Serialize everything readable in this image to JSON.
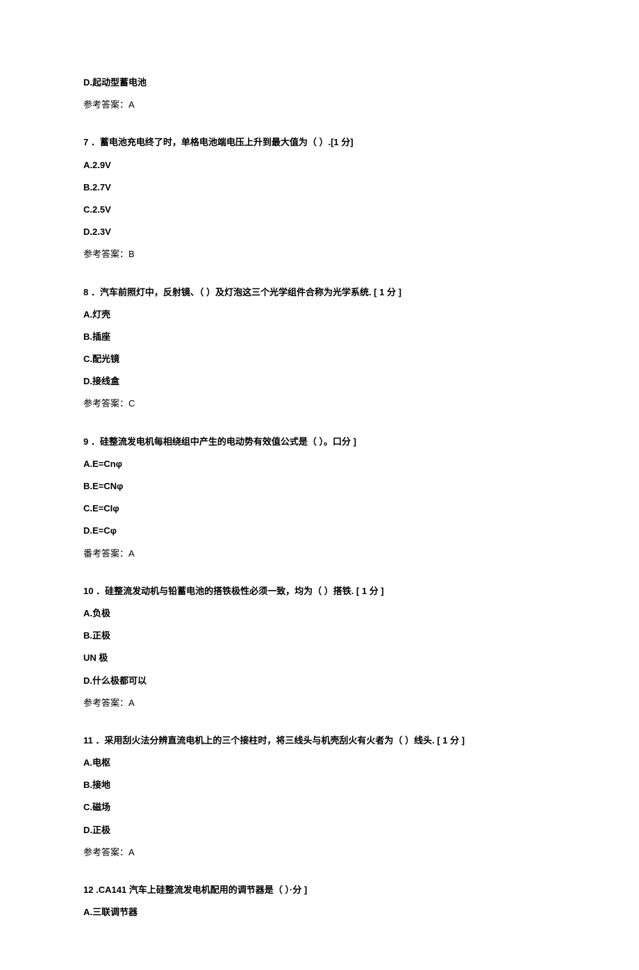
{
  "q6": {
    "optD": "D.起动型蓄电池",
    "answer": "参考答案：A"
  },
  "q7": {
    "num": "7",
    "stem": " ．蓄电池充电终了时，单格电池端电压上升到最大值为（ ）.[1 分]",
    "optA": "A.2.9V",
    "optB": "B.2.7V",
    "optC": "C.2.5V",
    "optD": "D.2.3V",
    "answer": "参考答案：B"
  },
  "q8": {
    "num": "8",
    "stem": " ．汽车前照灯中，反射镜、（           ）及灯泡这三个光学组件合称为光学系统. [ 1 分 ]",
    "optA": "A.灯壳",
    "optB": "B.插座",
    "optC": "C.配光镜",
    "optD": "D.接线盒",
    "answer": "参考答案：C"
  },
  "q9": {
    "num": "9",
    "stem": " ．硅整流发电机每相绕组中产生的电动势有效值公式是（ ）。口分 ]",
    "optA": "A.E=Cnφ",
    "optB": "B.E=CNφ",
    "optC": "C.E=CIφ",
    "optD": "D.E=Cφ",
    "answer": "番考答案：A"
  },
  "q10": {
    "num": "10",
    "stem": " ．硅整流发动机与铅蓄电池的搭铁极性必须一致，均为（ ）搭铁. [ 1 分 ]",
    "optA": "A.负极",
    "optB": "B.正极",
    "optC": "UN 极",
    "optD": "D.什么极都可以",
    "answer": "参考答案：A"
  },
  "q11": {
    "num": "11",
    "stem": " ．采用刮火法分辨直流电机上的三个接柱时，将三线头与机壳刮火有火者为（ ）线头. [ 1 分 ]",
    "optA": "A.电枢",
    "optB": "B.接地",
    "optC": "C.磁场",
    "optD": "D.正极",
    "answer": "参考答案：A"
  },
  "q12": {
    "num": "12",
    "stem": "  .CA141 汽车上硅整流发电机配用的调节器是（ ）·分 ]",
    "optA": "A.三联调节器"
  }
}
